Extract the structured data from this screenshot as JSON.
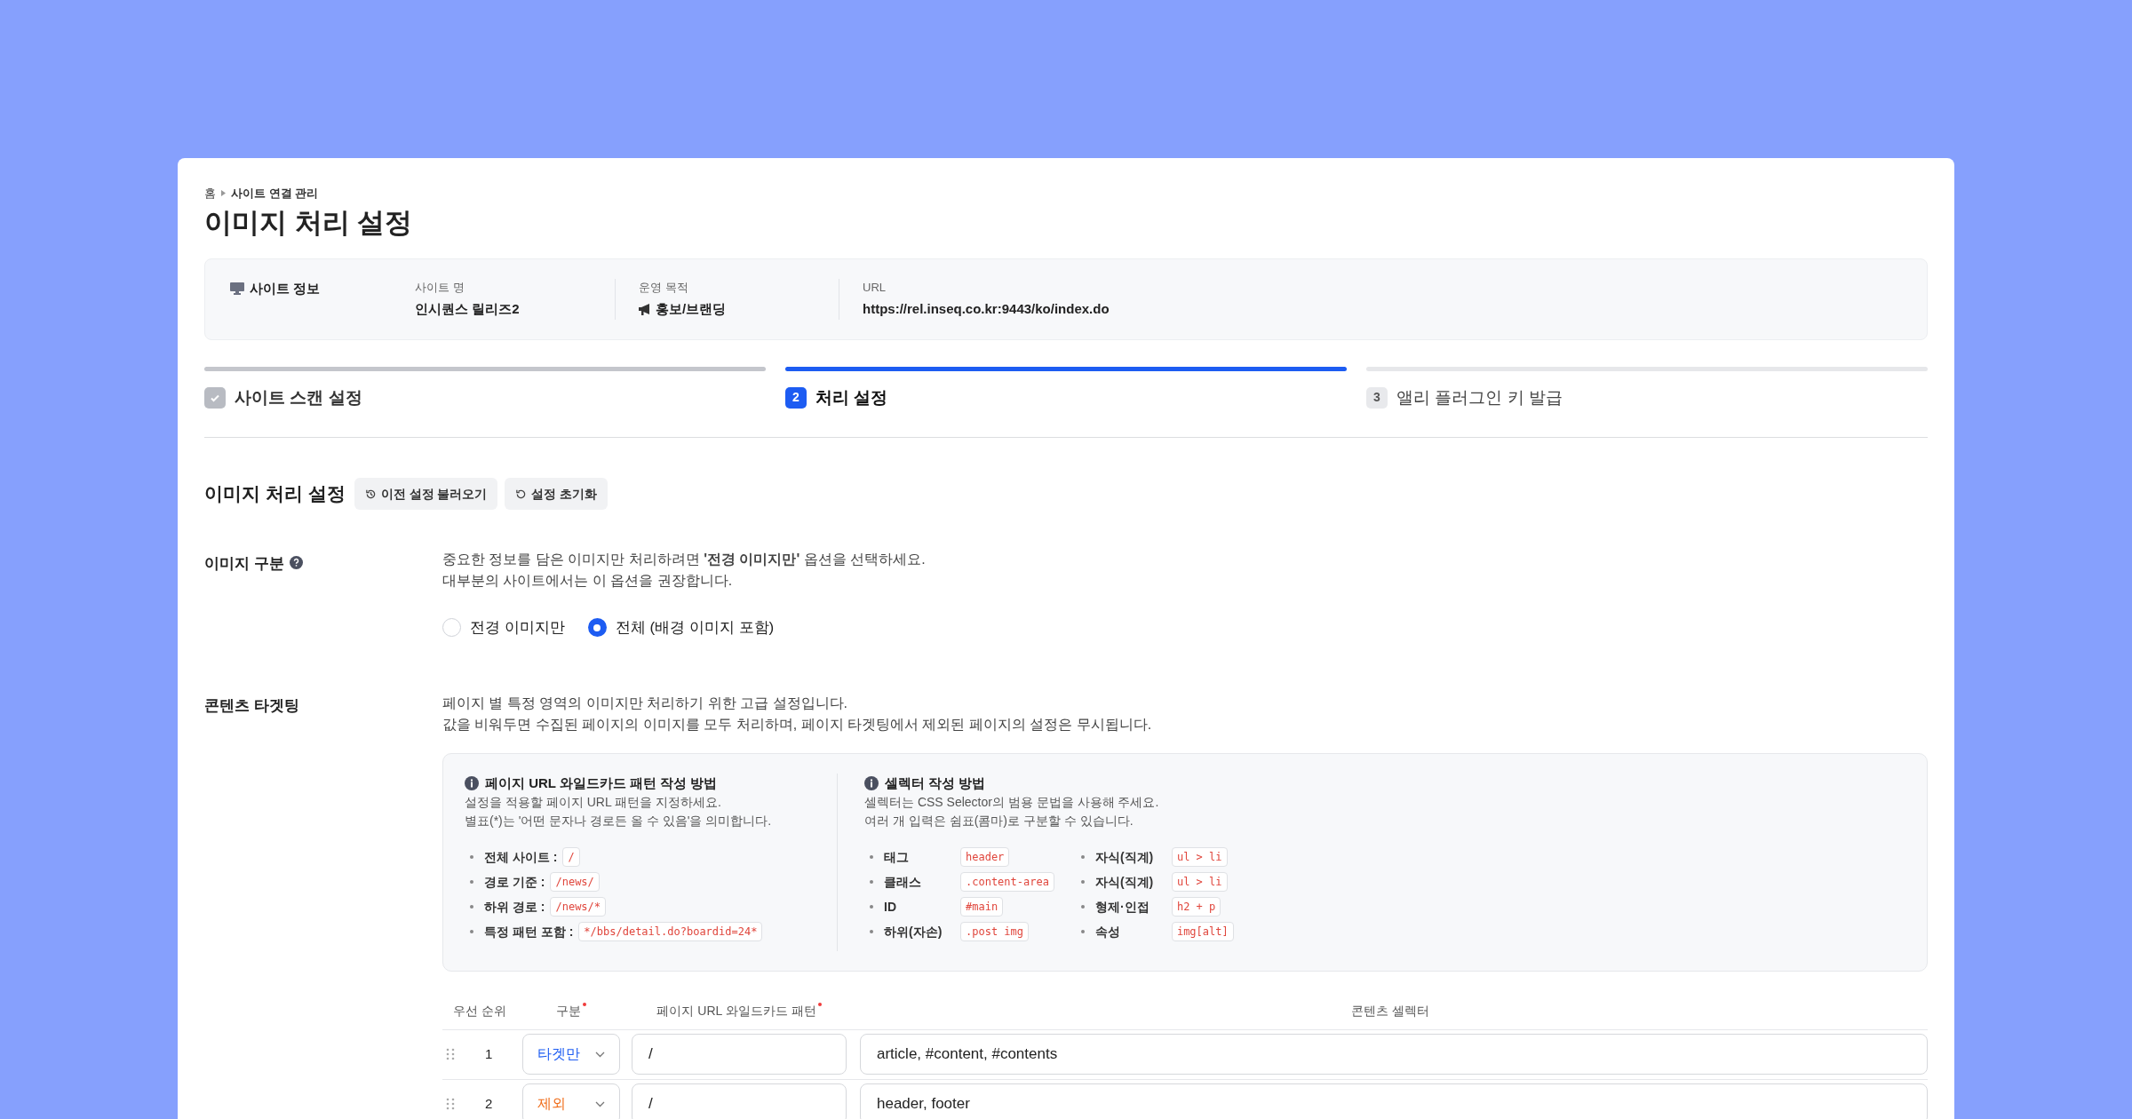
{
  "breadcrumb": [
    "홈",
    "사이트 연결 관리"
  ],
  "title": "이미지 처리 설정",
  "site_info": {
    "label": "사이트 정보",
    "fields": [
      {
        "kind": "text",
        "label": "사이트 명",
        "value": "인시퀀스 릴리즈2"
      },
      {
        "kind": "purpose",
        "label": "운영 목적",
        "value": "홍보/브랜딩"
      },
      {
        "kind": "text",
        "label": "URL",
        "value": "https://rel.inseq.co.kr:9443/ko/index.do"
      }
    ]
  },
  "steps": [
    {
      "label": "사이트 스캔 설정",
      "completed": true,
      "selected": false
    },
    {
      "marker": "2",
      "label": "처리 설정",
      "completed": false,
      "selected": true
    },
    {
      "marker": "3",
      "label": "앨리 플러그인 키 발급",
      "completed": false,
      "selected": false
    }
  ],
  "section": {
    "title": "이미지 처리 설정",
    "buttons": [
      {
        "kind": "history",
        "label": "이전 설정 불러오기"
      },
      {
        "kind": "reset",
        "label": "설정 초기화"
      }
    ]
  },
  "image_type": {
    "label": "이미지 구분",
    "description": [
      "중요한 정보를 담은 이미지만 처리하려면 **'전경 이미지만'** 옵션을 선택하세요.",
      "대부분의 사이트에서는 이 옵션을 권장합니다."
    ],
    "options": [
      {
        "label": "전경 이미지만",
        "selected": false
      },
      {
        "label": "전체 (배경 이미지 포함)",
        "selected": true
      }
    ]
  },
  "targeting": {
    "label": "콘텐츠 타겟팅",
    "description": [
      "페이지 별 특정 영역의 이미지만 처리하기 위한 고급 설정입니다.",
      "값을 비워두면 수집된 페이지의 이미지를 모두 처리하며, 페이지 타겟팅에서 제외된 페이지의 설정은 무시됩니다."
    ],
    "help": [
      {
        "title": "페이지 URL 와일드카드 패턴 작성 방법",
        "lines": [
          "설정을 적용할 페이지 URL 패턴을 지정하세요.",
          "별표(*)는 '어떤 문자나 경로든 올 수 있음'을 의미합니다."
        ],
        "columns": [
          [
            {
              "term": "전체 사이트 :",
              "code": "/"
            },
            {
              "term": "경로 기준 :",
              "code": "/news/"
            },
            {
              "term": "하위 경로 :",
              "code": "/news/*"
            },
            {
              "term": "특정 패턴 포함 :",
              "code": "*/bbs/detail.do?boardid=24*"
            }
          ]
        ]
      },
      {
        "title": "셀렉터 작성 방법",
        "lines": [
          "셀렉터는 CSS Selector의 범용 문법을 사용해 주세요.",
          "여러 개 입력은 쉼표(콤마)로 구분할 수 있습니다."
        ],
        "columns": [
          [
            {
              "term": "태그",
              "code": "header"
            },
            {
              "term": "클래스",
              "code": ".content-area"
            },
            {
              "term": "ID",
              "code": "#main"
            },
            {
              "term": "하위(자손)",
              "code": ".post img"
            }
          ],
          [
            {
              "term": "자식(직계)",
              "code": "ul > li"
            },
            {
              "term": "자식(직계)",
              "code": "ul > li"
            },
            {
              "term": "형제·인접",
              "code": "h2 + p"
            },
            {
              "term": "속성",
              "code": "img[alt]"
            }
          ]
        ]
      }
    ],
    "table": {
      "columns": [
        {
          "label": "우선 순위",
          "required": false
        },
        {
          "label": "구분",
          "required": true
        },
        {
          "label": "페이지 URL 와일드카드 패턴",
          "required": true
        },
        {
          "label": "콘텐츠 셀렉터",
          "required": false
        }
      ],
      "rows": [
        {
          "priority": "1",
          "kind": "target",
          "type": "타겟만",
          "pattern": "/",
          "selector": "article, #content, #contents"
        },
        {
          "priority": "2",
          "kind": "exclude",
          "type": "제외",
          "pattern": "/",
          "selector": "header, footer"
        }
      ]
    }
  }
}
